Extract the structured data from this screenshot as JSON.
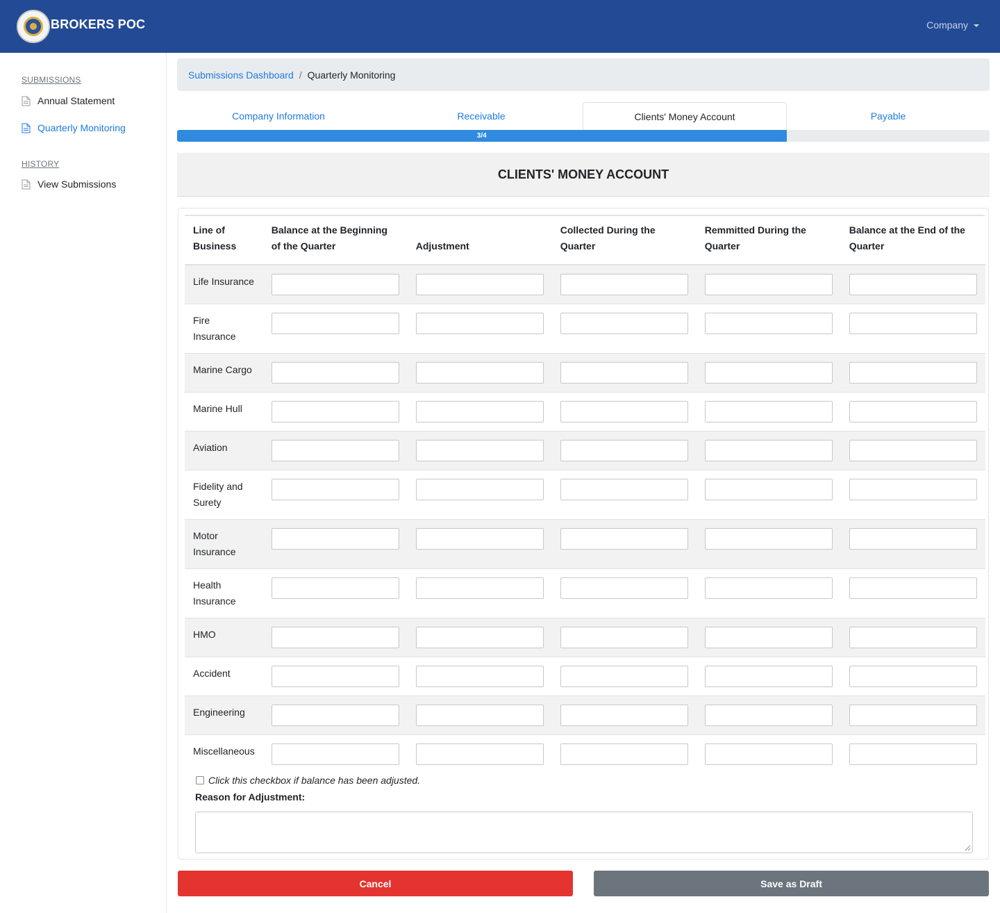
{
  "navbar": {
    "brand": "BROKERS POC",
    "company_menu": "Company"
  },
  "sidebar": {
    "submissions_heading": "SUBMISSIONS",
    "items": [
      {
        "label": "Annual Statement"
      },
      {
        "label": "Quarterly Monitoring"
      }
    ],
    "history_heading": "HISTORY",
    "history_items": [
      {
        "label": "View Submissions"
      }
    ]
  },
  "breadcrumb": {
    "link": "Submissions Dashboard",
    "separator": "/",
    "current": "Quarterly Monitoring"
  },
  "tabs": [
    {
      "label": "Company Information"
    },
    {
      "label": "Receivable"
    },
    {
      "label": "Clients' Money Account"
    },
    {
      "label": "Payable"
    }
  ],
  "progress": {
    "label": "3/4",
    "value": 0.75
  },
  "section_title": "CLIENTS' MONEY ACCOUNT",
  "table": {
    "headers": [
      "Line of Business",
      "Balance at the Beginning of the Quarter",
      "Adjustment",
      "Collected During the Quarter",
      "Remmitted During the Quarter",
      "Balance at the End of the Quarter"
    ],
    "rows": [
      {
        "line": "Life Insurance"
      },
      {
        "line": "Fire Insurance"
      },
      {
        "line": "Marine Cargo"
      },
      {
        "line": "Marine Hull"
      },
      {
        "line": "Aviation"
      },
      {
        "line": "Fidelity and Surety"
      },
      {
        "line": "Motor Insurance"
      },
      {
        "line": "Health Insurance"
      },
      {
        "line": "HMO"
      },
      {
        "line": "Accident"
      },
      {
        "line": "Engineering"
      },
      {
        "line": "Miscellaneous"
      }
    ]
  },
  "adjustment": {
    "checkbox_label": "Click this checkbox if balance has been adjusted.",
    "reason_label": "Reason for Adjustment:",
    "reason_value": ""
  },
  "buttons": {
    "cancel": "Cancel",
    "save_draft": "Save as Draft"
  },
  "colors": {
    "navbar": "#234a94",
    "accent": "#1f7be0",
    "progress": "#2f8ae0",
    "cancel": "#e3342f",
    "draft": "#6c757d"
  }
}
